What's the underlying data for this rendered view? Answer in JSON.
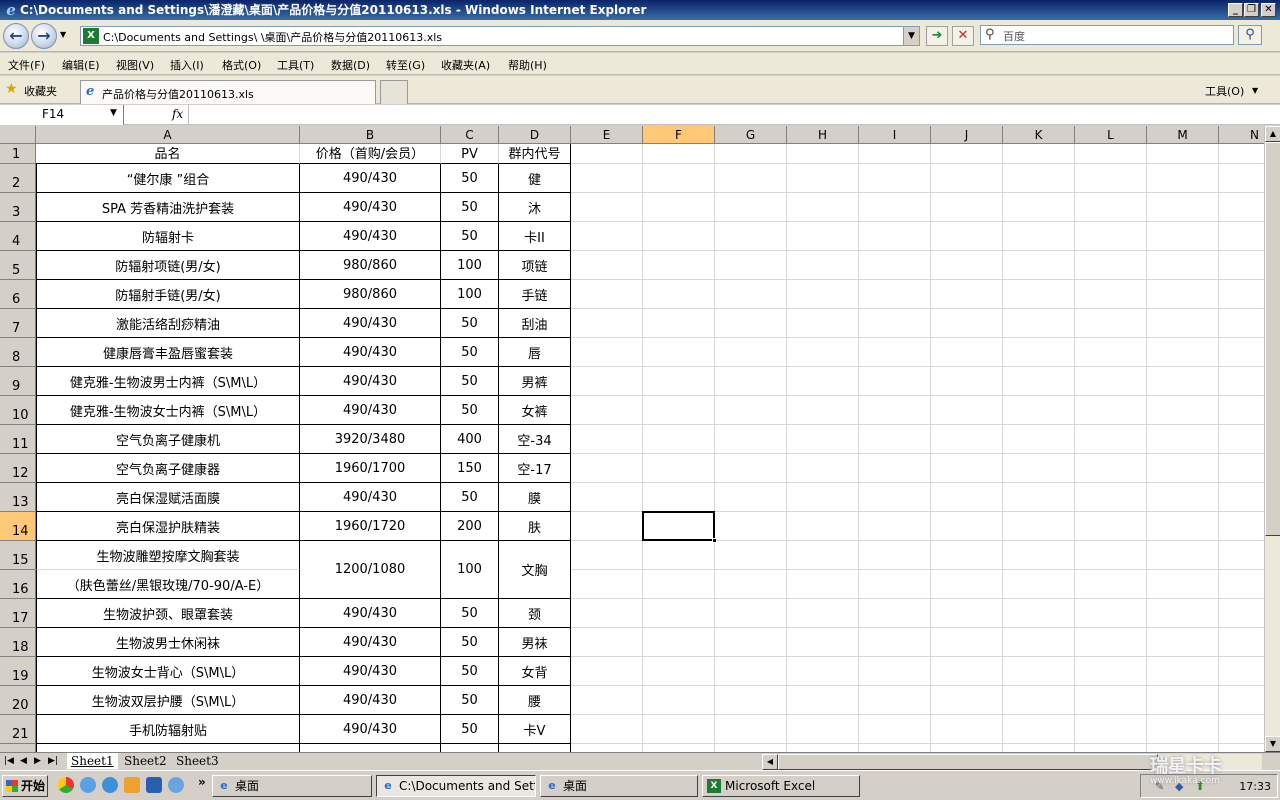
{
  "window": {
    "title": "C:\\Documents and Settings\\潘澄藏\\桌面\\产品价格与分值20110613.xls - Windows Internet Explorer"
  },
  "address_bar": {
    "url": "C:\\Documents and Settings\\          \\桌面\\产品价格与分值20110613.xls",
    "search_placeholder": "百度"
  },
  "menu": {
    "items": [
      "文件(F)",
      "编辑(E)",
      "视图(V)",
      "插入(I)",
      "格式(O)",
      "工具(T)",
      "数据(D)",
      "转至(G)",
      "收藏夹(A)",
      "帮助(H)"
    ]
  },
  "favorites": {
    "label": "收藏夹",
    "tab_title": "产品价格与分值20110613.xls",
    "tools_label": "工具(O)"
  },
  "formula_bar": {
    "name_box": "F14",
    "fx": "fx",
    "value": ""
  },
  "columns": [
    "A",
    "B",
    "C",
    "D",
    "E",
    "F",
    "G",
    "H",
    "I",
    "J",
    "K",
    "L",
    "M",
    "N"
  ],
  "selected_column": "F",
  "selected_row": "14",
  "table": {
    "header": [
      "品名",
      "价格（首购/会员）",
      "PV",
      "群内代号"
    ],
    "rows": [
      {
        "row": "2",
        "name": "“健尔康 ”组合",
        "price": "490/430",
        "pv": "50",
        "code": "健"
      },
      {
        "row": "3",
        "name": "SPA 芳香精油洗护套装",
        "price": "490/430",
        "pv": "50",
        "code": "沐"
      },
      {
        "row": "4",
        "name": "防辐射卡",
        "price": "490/430",
        "pv": "50",
        "code": "卡II"
      },
      {
        "row": "5",
        "name": "防辐射项链(男/女)",
        "price": "980/860",
        "pv": "100",
        "code": "项链"
      },
      {
        "row": "6",
        "name": "防辐射手链(男/女)",
        "price": "980/860",
        "pv": "100",
        "code": "手链"
      },
      {
        "row": "7",
        "name": "激能活络刮痧精油",
        "price": "490/430",
        "pv": "50",
        "code": "刮油"
      },
      {
        "row": "8",
        "name": "健康唇膏丰盈唇蜜套装",
        "price": "490/430",
        "pv": "50",
        "code": "唇"
      },
      {
        "row": "9",
        "name": "健克雅-生物波男士内裤（S\\M\\L）",
        "price": "490/430",
        "pv": "50",
        "code": "男裤"
      },
      {
        "row": "10",
        "name": "健克雅-生物波女士内裤（S\\M\\L）",
        "price": "490/430",
        "pv": "50",
        "code": "女裤"
      },
      {
        "row": "11",
        "name": "空气负离子健康机",
        "price": "3920/3480",
        "pv": "400",
        "code": "空-34"
      },
      {
        "row": "12",
        "name": "空气负离子健康器",
        "price": "1960/1700",
        "pv": "150",
        "code": "空-17"
      },
      {
        "row": "13",
        "name": "亮白保湿赋活面膜",
        "price": "490/430",
        "pv": "50",
        "code": "膜"
      },
      {
        "row": "14",
        "name": "亮白保湿护肤精装",
        "price": "1960/1720",
        "pv": "200",
        "code": "肤"
      },
      {
        "row": "15",
        "name": "生物波雕塑按摩文胸套装",
        "price": "1200/1080",
        "pv": "100",
        "code": "文胸"
      },
      {
        "row": "16",
        "name": "（肤色蕾丝/黑银玫瑰/70-90/A-E）",
        "price": "",
        "pv": "",
        "code": ""
      },
      {
        "row": "17",
        "name": "生物波护颈、眼罩套装",
        "price": "490/430",
        "pv": "50",
        "code": "颈"
      },
      {
        "row": "18",
        "name": "生物波男士休闲袜",
        "price": "490/430",
        "pv": "50",
        "code": "男袜"
      },
      {
        "row": "19",
        "name": "生物波女士背心（S\\M\\L）",
        "price": "490/430",
        "pv": "50",
        "code": "女背"
      },
      {
        "row": "20",
        "name": "生物波双层护腰（S\\M\\L）",
        "price": "490/430",
        "pv": "50",
        "code": "腰"
      },
      {
        "row": "21",
        "name": "手机防辐射贴",
        "price": "490/430",
        "pv": "50",
        "code": "卡V"
      }
    ]
  },
  "sheets": [
    "Sheet1",
    "Sheet2",
    "Sheet3"
  ],
  "active_sheet": "Sheet1",
  "taskbar": {
    "start": "开始",
    "tasks": [
      "桌面",
      "C:\\Documents and Settin...",
      "桌面",
      "Microsoft Excel"
    ],
    "clock": "17:33"
  },
  "watermark": {
    "main": "瑞星卡卡",
    "sub": "www.ikaka.com"
  },
  "colors": {
    "title_bar": "#0a246a",
    "selection_header": "#ffc876",
    "chrome": "#d4d0c8"
  }
}
